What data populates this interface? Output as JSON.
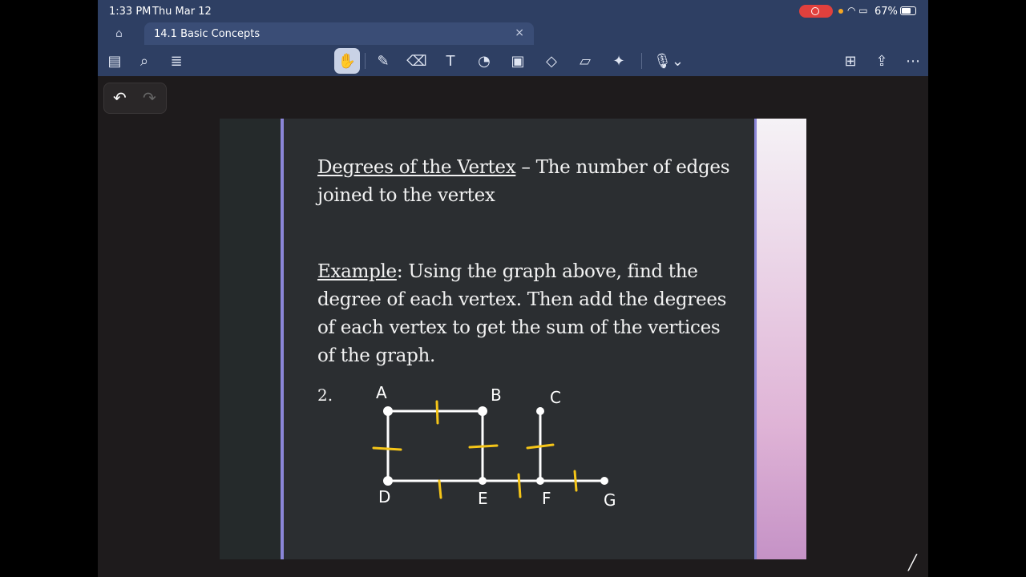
{
  "status_bar": {
    "time": "1:33 PM",
    "date": "Thu Mar 12",
    "battery": "67%"
  },
  "tab": {
    "title": "14.1 Basic Concepts"
  },
  "slide": {
    "definition_term": "Degrees of the Vertex",
    "definition_rest": " – The number of edges joined to the vertex",
    "example_term": "Example",
    "example_rest": ": Using the graph above, find the degree of each vertex. Then add the degrees of each vertex to get the sum of the vertices of the graph.",
    "problem_number": "2.",
    "vertex_labels": [
      "A",
      "B",
      "C",
      "D",
      "E",
      "F",
      "G"
    ]
  },
  "colors": {
    "toolbar": "#2e3f63",
    "accent": "#8b86d8",
    "ink": "#f5c518"
  }
}
